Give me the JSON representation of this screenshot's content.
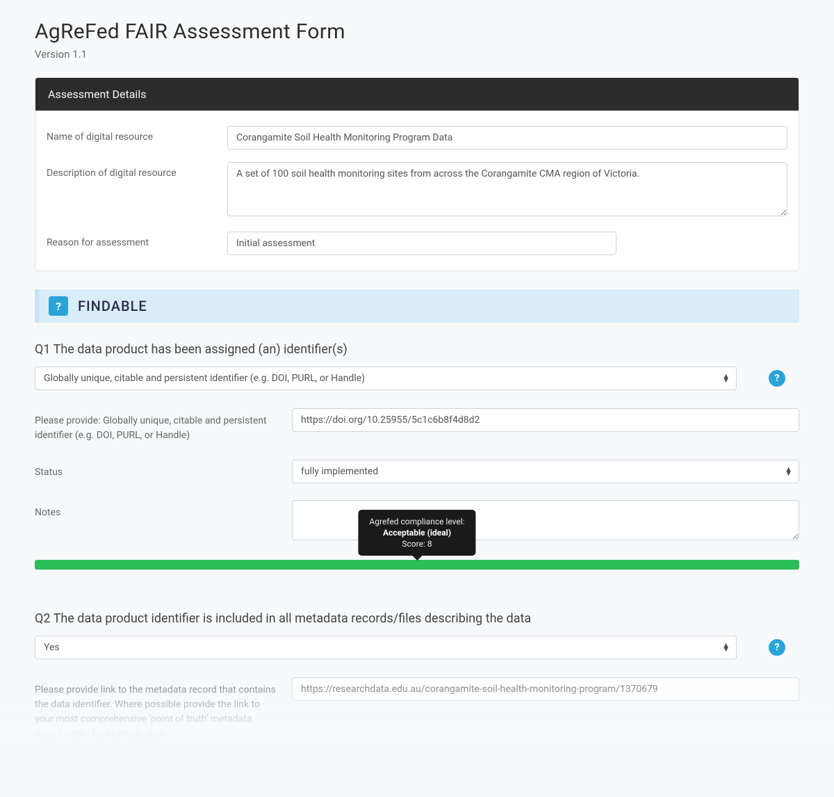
{
  "header": {
    "title": "AgReFed FAIR Assessment Form",
    "version": "Version 1.1"
  },
  "details": {
    "panel_title": "Assessment Details",
    "name_label": "Name of digital resource",
    "name_value": "Corangamite Soil Health Monitoring Program Data",
    "description_label": "Description of digital resource",
    "description_value": "A set of 100 soil health monitoring sites from across the Corangamite CMA region of Victoria.",
    "reason_label": "Reason for assessment",
    "reason_value": "Initial assessment"
  },
  "findable": {
    "section_label": "FINDABLE",
    "help_glyph": "?"
  },
  "q1": {
    "question": "Q1 The data product has been assigned (an) identifier(s)",
    "select_value": "Globally unique, citable and persistent identifier (e.g. DOI, PURL, or Handle)",
    "provide_label": "Please provide: Globally unique, citable and persistent identifier (e.g. DOI, PURL, or Handle)",
    "provide_value": "https://doi.org/10.25955/5c1c6b8f4d8d2",
    "status_label": "Status",
    "status_value": "fully implemented",
    "notes_label": "Notes",
    "notes_value": "",
    "tooltip_line1": "Agrefed compliance level:",
    "tooltip_line2": "Acceptable (ideal)",
    "tooltip_line3": "Score: 8"
  },
  "q2": {
    "question": "Q2 The data product identifier is included in all metadata records/files describing the data",
    "select_value": "Yes",
    "provide_label": "Please provide link to the metadata record that contains the data identifier. Where possible provide the link to your most comprehensive 'point of truth' metadata record here - for example, your",
    "provide_value": "https://researchdata.edu.au/corangamite-soil-health-monitoring-program/1370679"
  }
}
